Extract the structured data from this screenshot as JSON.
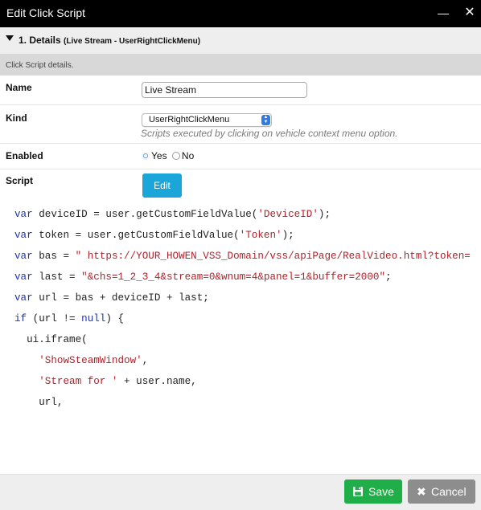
{
  "window": {
    "title": "Edit Click Script",
    "minimize_glyph": "—",
    "close_glyph": "✕"
  },
  "section": {
    "title": "1. Details",
    "subtitle": "(Live Stream - UserRightClickMenu)",
    "description": "Click Script details."
  },
  "form": {
    "name_label": "Name",
    "name_value": "Live Stream",
    "kind_label": "Kind",
    "kind_value": "UserRightClickMenu",
    "kind_hint": "Scripts executed by clicking on vehicle context menu option.",
    "enabled_label": "Enabled",
    "enabled_yes": "Yes",
    "enabled_no": "No",
    "enabled_selected": "Yes",
    "script_label": "Script",
    "edit_button": "Edit"
  },
  "code": {
    "lines": [
      [
        {
          "t": "var",
          "c": "kw"
        },
        {
          "t": " deviceID = user.getCustomFieldValue("
        },
        {
          "t": "'DeviceID'",
          "c": "str"
        },
        {
          "t": ");"
        }
      ],
      [
        {
          "t": "var",
          "c": "kw"
        },
        {
          "t": " token = user.getCustomFieldValue("
        },
        {
          "t": "'Token'",
          "c": "str"
        },
        {
          "t": ");"
        }
      ],
      [
        {
          "t": "var",
          "c": "kw"
        },
        {
          "t": " bas = "
        },
        {
          "t": "\" https://YOUR_HOWEN_VSS_Domain/vss/apiPage/RealVideo.html?token=",
          "c": "str"
        }
      ],
      [
        {
          "t": "var",
          "c": "kw"
        },
        {
          "t": " last = "
        },
        {
          "t": "\"&chs=1_2_3_4&stream=0&wnum=4&panel=1&buffer=2000\"",
          "c": "str"
        },
        {
          "t": ";"
        }
      ],
      [
        {
          "t": "var",
          "c": "kw"
        },
        {
          "t": " url = bas + deviceID + last;"
        }
      ],
      [
        {
          "t": "if",
          "c": "kw"
        },
        {
          "t": " (url != "
        },
        {
          "t": "null",
          "c": "nul"
        },
        {
          "t": ") {"
        }
      ],
      [
        {
          "t": "  ui.iframe("
        }
      ],
      [
        {
          "t": "    "
        },
        {
          "t": "'ShowSteamWindow'",
          "c": "str"
        },
        {
          "t": ","
        }
      ],
      [
        {
          "t": "    "
        },
        {
          "t": "'Stream for '",
          "c": "str"
        },
        {
          "t": " + user.name,"
        }
      ],
      [
        {
          "t": "    url,"
        }
      ]
    ]
  },
  "footer": {
    "save_label": "Save",
    "cancel_label": "Cancel"
  },
  "colors": {
    "titlebar": "#000000",
    "section_bg": "#eeeeee",
    "desc_bg": "#d8d8d8",
    "edit_button": "#1aa6d8",
    "save_button": "#1fae47",
    "cancel_button": "#8d8d8d",
    "code_keyword": "#1f33a8",
    "code_string": "#b2212b",
    "radio_selected": "#2f7be4"
  }
}
